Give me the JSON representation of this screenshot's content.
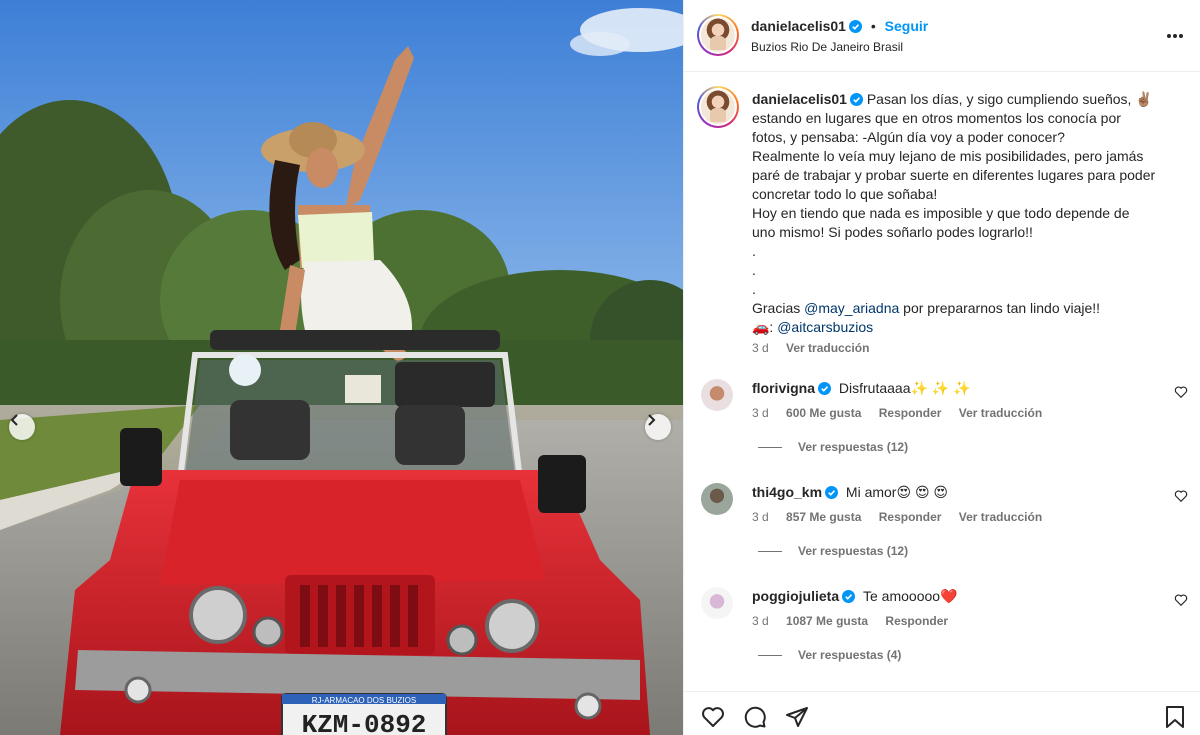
{
  "post": {
    "username": "danielacelis01",
    "follow_label": "Seguir",
    "separator": "•",
    "location": "Buzios Rio De Janeiro Brasil",
    "verified": true
  },
  "caption": {
    "line1": "Pasan los días, y sigo cumpliendo sueños, ✌🏽",
    "line2": "estando en lugares que en otros momentos los conocía por",
    "line3": "fotos, y pensaba: -Algún día voy a poder conocer?",
    "line4": "Realmente lo veía muy lejano de mis posibilidades, pero jamás",
    "line5": "paré de trabajar y probar suerte en diferentes lugares para poder",
    "line6": "concretar todo lo que soñaba!",
    "line7": "Hoy en tiendo que nada es imposible y que todo depende de",
    "line8": "uno mismo! Si podes soñarlo podes lograrlo!!",
    "dot": ".",
    "thanks_prefix": "Gracias ",
    "thanks_mention": "@may_ariadna",
    "thanks_suffix": " por prepararnos tan lindo viaje!!",
    "car_prefix": "🚗: ",
    "car_mention": "@aitcarsbuzios",
    "time": "3 d",
    "see_translation": "Ver traducción"
  },
  "comments": [
    {
      "username": "florivigna",
      "text": "Disfrutaaaa✨ ✨ ✨",
      "time": "3 d",
      "likes": "600 Me gusta",
      "reply": "Responder",
      "translate": "Ver traducción",
      "replies": "Ver respuestas (12)"
    },
    {
      "username": "thi4go_km",
      "text": "Mi amor😍 😍 😍",
      "time": "3 d",
      "likes": "857 Me gusta",
      "reply": "Responder",
      "translate": "Ver traducción",
      "replies": "Ver respuestas (12)"
    },
    {
      "username": "poggiojulieta",
      "text": "Te amooooo❤️",
      "time": "3 d",
      "likes": "1087 Me gusta",
      "reply": "Responder",
      "replies": "Ver respuestas (4)"
    }
  ],
  "media": {
    "plate_text": "KZM-0892",
    "plate_header": "RJ-ARMACAO DOS BUZIOS"
  },
  "colors": {
    "link": "#0095f6",
    "mention": "#00376b",
    "verified": "#0095f6",
    "muted": "#737373",
    "car_red": "#d8232a"
  },
  "icons": [
    "more-options-icon",
    "verified-icon",
    "heart-icon",
    "comment-icon",
    "share-icon",
    "bookmark-icon",
    "chevron-left-icon",
    "chevron-right-icon"
  ]
}
